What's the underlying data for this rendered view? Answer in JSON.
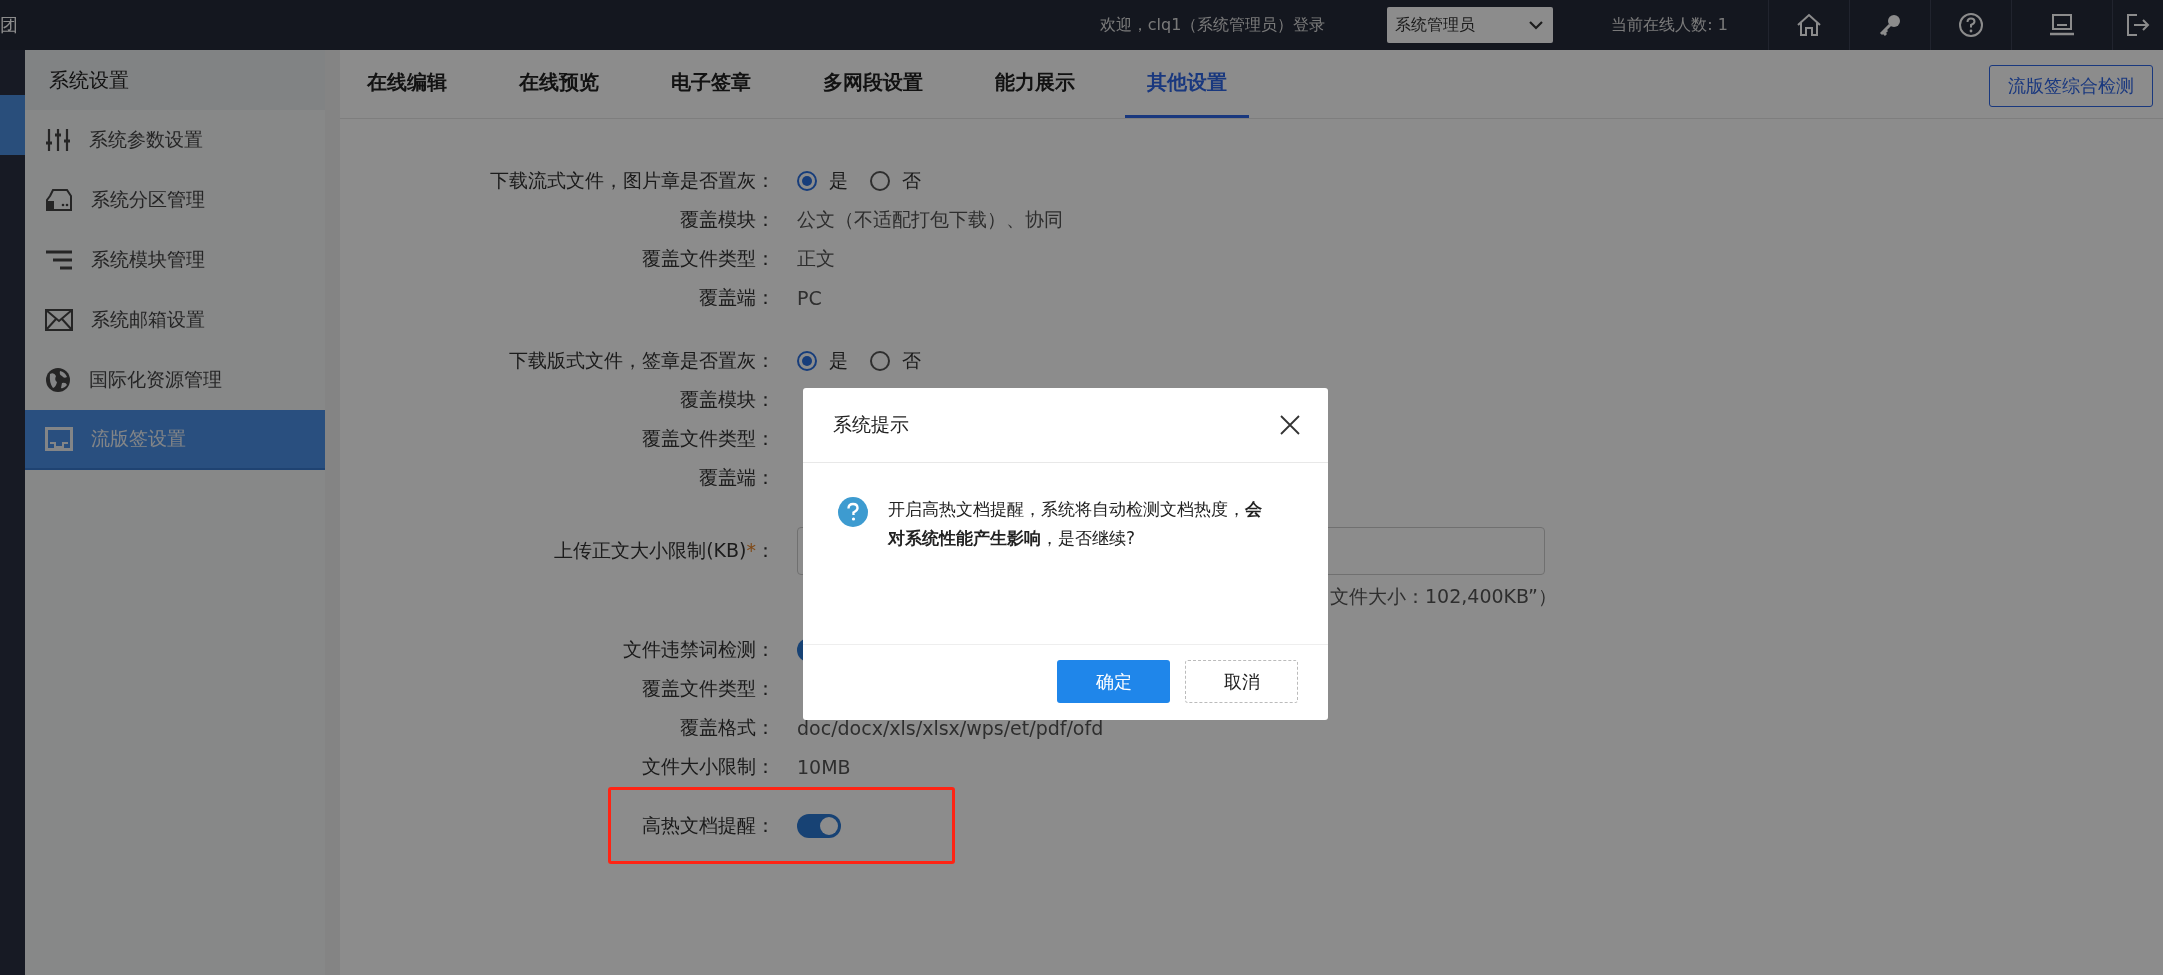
{
  "app": {
    "brand": "团"
  },
  "top_bar": {
    "welcome": "欢迎，clq1（系统管理员）登录",
    "role_select": {
      "value": "系统管理员"
    },
    "online_count": "当前在线人数: 1"
  },
  "sidebar": {
    "title": "系统设置",
    "items": [
      {
        "label": "系统参数设置",
        "selected": false
      },
      {
        "label": "系统分区管理",
        "selected": false
      },
      {
        "label": "系统模块管理",
        "selected": false
      },
      {
        "label": "系统邮箱设置",
        "selected": false
      },
      {
        "label": "国际化资源管理",
        "selected": false
      },
      {
        "label": "流版签设置",
        "selected": true
      }
    ]
  },
  "tabs": [
    {
      "label": "在线编辑",
      "selected": false
    },
    {
      "label": "在线预览",
      "selected": false
    },
    {
      "label": "电子签章",
      "selected": false
    },
    {
      "label": "多网段设置",
      "selected": false
    },
    {
      "label": "能力展示",
      "selected": false
    },
    {
      "label": "其他设置",
      "selected": true
    }
  ],
  "action_button": "流版签综合检测",
  "groups": [
    {
      "rows": [
        {
          "kind": "radio",
          "label": "下载流式文件，图片章是否置灰：",
          "options": [
            {
              "label": "是",
              "selected": true
            },
            {
              "label": "否",
              "selected": false
            }
          ]
        },
        {
          "kind": "text",
          "label": "覆盖模块：",
          "value": "公文（不适配打包下载）、协同"
        },
        {
          "kind": "text",
          "label": "覆盖文件类型：",
          "value": "正文"
        },
        {
          "kind": "text",
          "label": "覆盖端：",
          "value": "PC"
        }
      ]
    },
    {
      "rows": [
        {
          "kind": "radio",
          "label": "下载版式文件，签章是否置灰：",
          "options": [
            {
              "label": "是",
              "selected": true
            },
            {
              "label": "否",
              "selected": false
            }
          ]
        },
        {
          "kind": "text",
          "label": "覆盖模块："
        },
        {
          "kind": "text",
          "label": "覆盖文件类型："
        },
        {
          "kind": "text",
          "label": "覆盖端："
        }
      ]
    },
    {
      "rows": [
        {
          "kind": "input",
          "label": "上传正文大小限制(KB)",
          "mark": "*",
          "label_end": "："
        },
        {
          "kind": "hint",
          "value": "文件大小：102,400KB”）"
        }
      ]
    },
    {
      "rows": [
        {
          "kind": "switch",
          "label": "文件违禁词检测：",
          "on": true
        },
        {
          "kind": "text",
          "label": "覆盖文件类型："
        },
        {
          "kind": "text",
          "label": "覆盖格式：",
          "value": "doc/docx/xls/xlsx/wps/et/pdf/ofd"
        },
        {
          "kind": "text",
          "label": "文件大小限制：",
          "value": "10MB"
        },
        {
          "kind": "switch",
          "label": "高热文档提醒：",
          "on": true,
          "highlighted": true
        }
      ]
    }
  ],
  "dialog": {
    "title": "系统提示",
    "message": "开启高热文档提醒，系统将自动检测文档热度，**会对系统性能产生影响**，是否继续?",
    "buttons": [
      {
        "label": "确定",
        "primary": true
      },
      {
        "label": "取消",
        "primary": false
      }
    ]
  }
}
